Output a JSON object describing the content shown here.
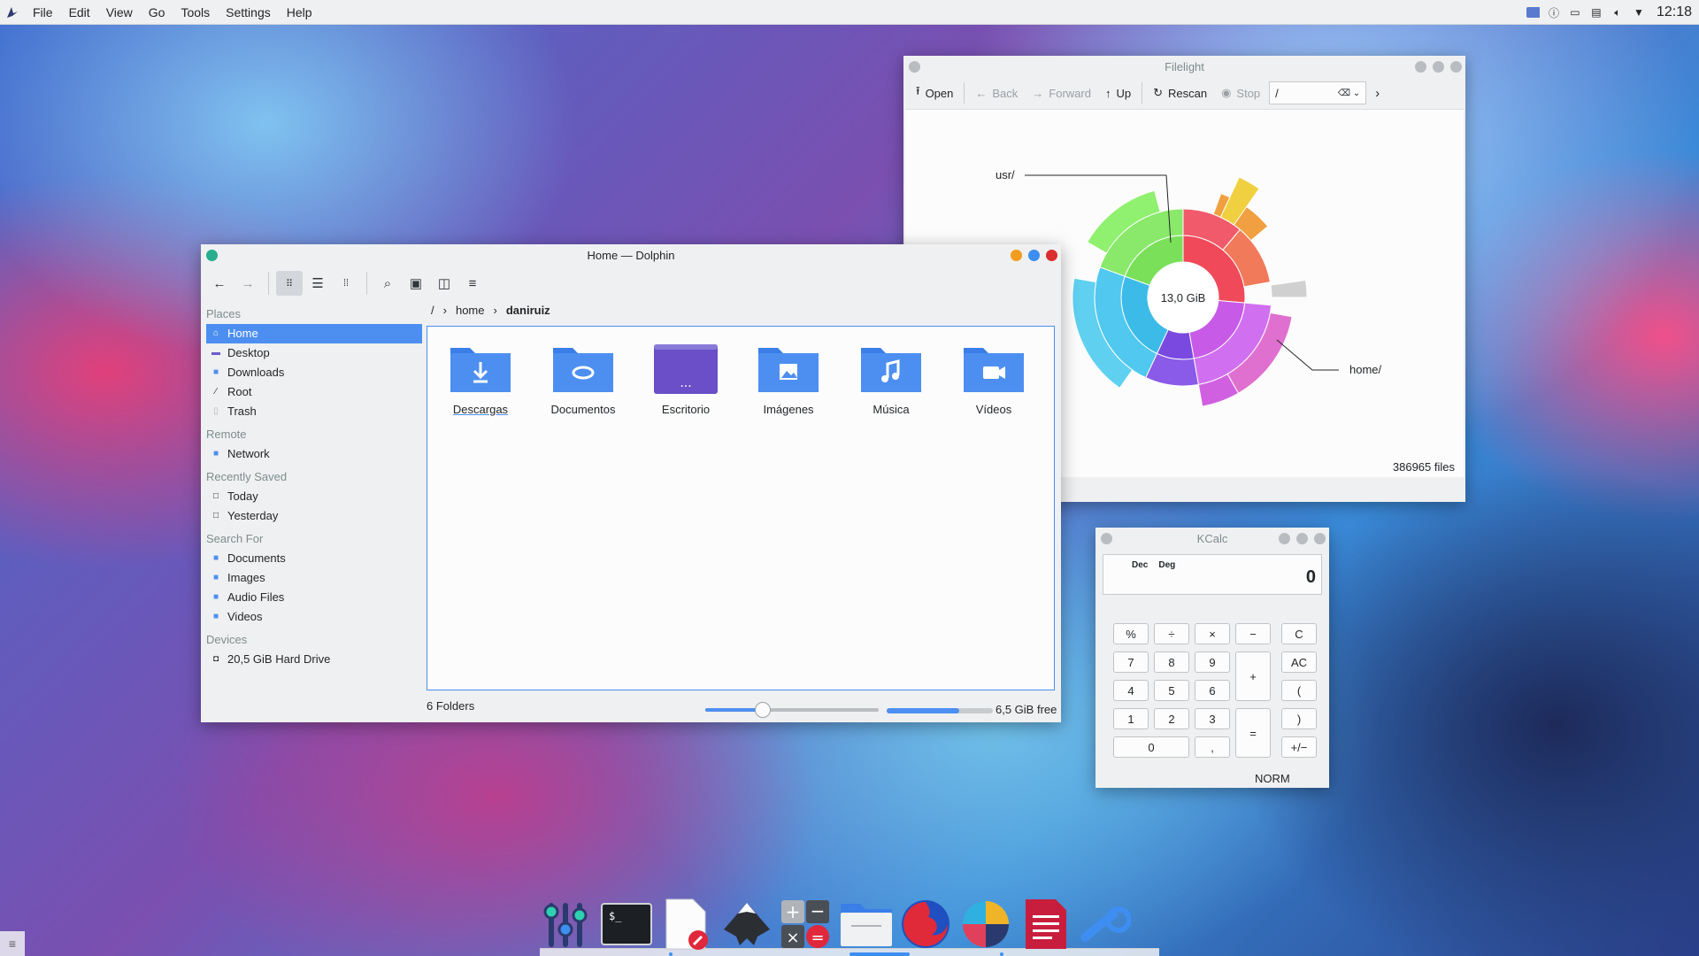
{
  "menubar": {
    "items": [
      "File",
      "Edit",
      "View",
      "Go",
      "Tools",
      "Settings",
      "Help"
    ],
    "clock": "12:18"
  },
  "dolphin": {
    "title": "Home — Dolphin",
    "places_header": "Places",
    "places": [
      "Home",
      "Desktop",
      "Downloads",
      "Root",
      "Trash"
    ],
    "remote_header": "Remote",
    "remote": [
      "Network"
    ],
    "recent_header": "Recently Saved",
    "recent": [
      "Today",
      "Yesterday"
    ],
    "search_header": "Search For",
    "search": [
      "Documents",
      "Images",
      "Audio Files",
      "Videos"
    ],
    "devices_header": "Devices",
    "devices": [
      "20,5 GiB Hard Drive"
    ],
    "breadcrumb": [
      "/",
      "home",
      "daniruiz"
    ],
    "folders": [
      "Descargas",
      "Documentos",
      "Escritorio",
      "Imágenes",
      "Música",
      "Vídeos"
    ],
    "status": "6 Folders",
    "free": "6,5 GiB free",
    "zoom_fraction": 0.33,
    "used_fraction": 0.68,
    "accent": "#4d8ff0"
  },
  "filelight": {
    "title": "Filelight",
    "toolbar": {
      "open": "Open",
      "back": "Back",
      "forward": "Forward",
      "up": "Up",
      "rescan": "Rescan",
      "stop": "Stop",
      "path": "/"
    },
    "center_label": "13,0 GiB",
    "labels": {
      "usr": "usr/",
      "home": "home/"
    },
    "status": "386965 files"
  },
  "kcalc": {
    "title": "KCalc",
    "flags": [
      "Dec",
      "Deg"
    ],
    "display": "0",
    "buttons": {
      "r1": [
        "%",
        "÷",
        "×",
        "−",
        "C"
      ],
      "r2": [
        "7",
        "8",
        "9",
        "+",
        "AC"
      ],
      "r3": [
        "4",
        "5",
        "6",
        "("
      ],
      "r4": [
        "1",
        "2",
        "3",
        "=",
        ")"
      ],
      "r5": [
        "0",
        ",",
        "+/−"
      ]
    },
    "mode": "NORM"
  },
  "dock": {
    "apps": [
      "system-settings-icon",
      "terminal-icon",
      "text-editor-icon",
      "inkscape-icon",
      "calculator-icon",
      "file-manager-icon",
      "firefox-icon",
      "filelight-icon",
      "document-viewer-icon",
      "kde-connect-icon"
    ]
  }
}
